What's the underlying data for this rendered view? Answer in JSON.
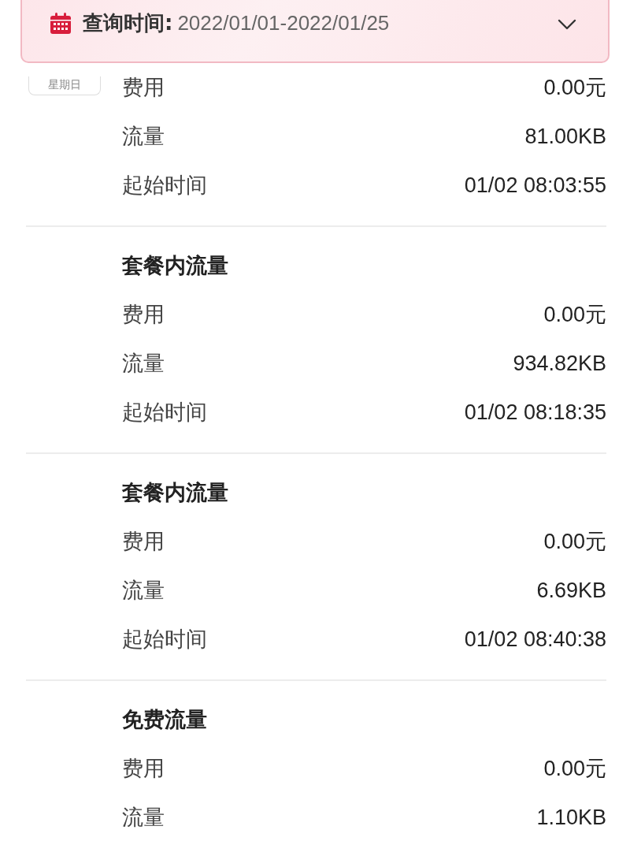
{
  "query": {
    "label": "查询时间:",
    "range": "2022/01/01-2022/01/25",
    "expanded": false
  },
  "records": [
    {
      "day_badge": "星期日",
      "fields": [
        {
          "label": "费用",
          "value": "0.00元"
        },
        {
          "label": "流量",
          "value": "81.00KB"
        },
        {
          "label": "起始时间",
          "value": "01/02 08:03:55"
        }
      ]
    },
    {
      "title": "套餐内流量",
      "fields": [
        {
          "label": "费用",
          "value": "0.00元"
        },
        {
          "label": "流量",
          "value": "934.82KB"
        },
        {
          "label": "起始时间",
          "value": "01/02 08:18:35"
        }
      ]
    },
    {
      "title": "套餐内流量",
      "fields": [
        {
          "label": "费用",
          "value": "0.00元"
        },
        {
          "label": "流量",
          "value": "6.69KB"
        },
        {
          "label": "起始时间",
          "value": "01/02 08:40:38"
        }
      ]
    },
    {
      "title": "免费流量",
      "fields": [
        {
          "label": "费用",
          "value": "0.00元"
        },
        {
          "label": "流量",
          "value": "1.10KB"
        }
      ]
    }
  ]
}
